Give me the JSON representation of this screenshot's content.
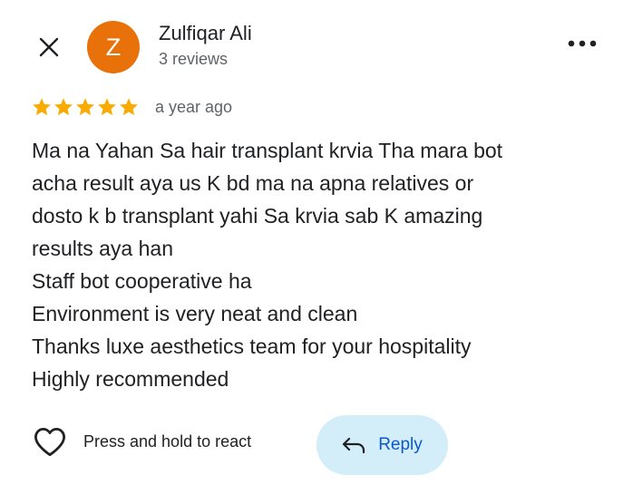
{
  "header": {
    "avatar_letter": "Z",
    "avatar_color": "#e8710a",
    "reviewer_name": "Zulfiqar Ali",
    "review_count": "3 reviews",
    "close_icon": "close-icon",
    "more_icon": "more-horizontal-icon"
  },
  "rating": {
    "stars": 5,
    "max_stars": 5,
    "star_color": "#f9ab00",
    "time_ago": "a year ago"
  },
  "review": {
    "lines": [
      "Ma na Yahan Sa hair transplant krvia Tha mara bot",
      "acha result aya us K bd ma na apna relatives or",
      "dosto k b transplant yahi Sa krvia sab K amazing",
      "results aya han",
      "Staff bot cooperative ha",
      "Environment is very neat and clean",
      "Thanks luxe aesthetics team for your hospitality",
      "Highly recommended"
    ]
  },
  "actions": {
    "react_label": "Press and hold to react",
    "react_icon": "heart-outline-icon",
    "reply_label": "Reply",
    "reply_icon": "reply-arrow-icon",
    "reply_bg": "#d3eef8",
    "reply_text_color": "#0b57d0"
  }
}
